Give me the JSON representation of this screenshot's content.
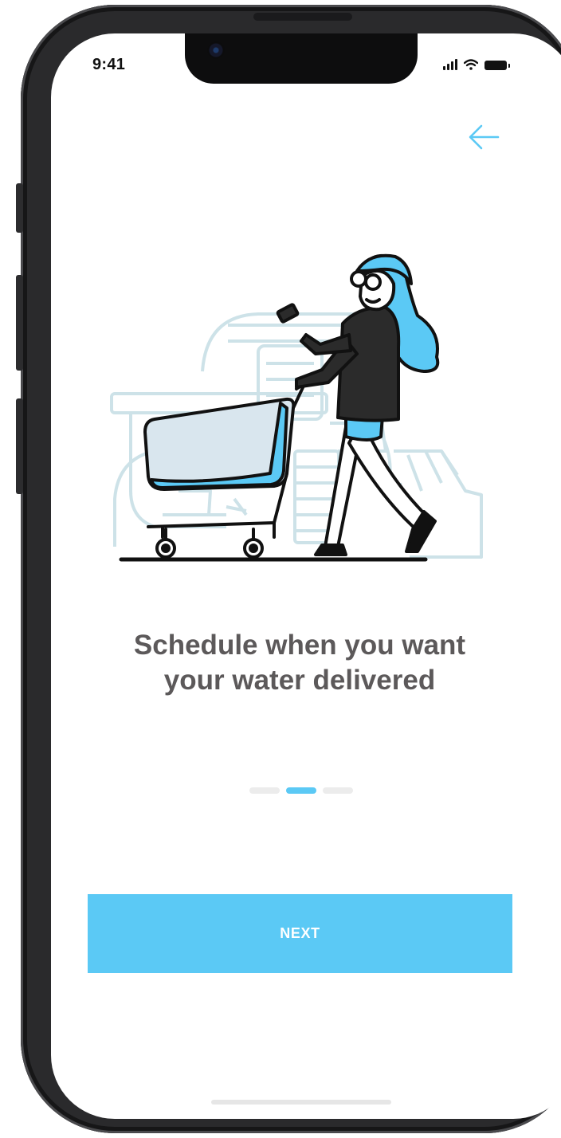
{
  "status_bar": {
    "time": "9:41"
  },
  "onboarding": {
    "headline_line1": "Schedule when you want",
    "headline_line2": "your water delivered",
    "total_steps": 3,
    "current_step": 2,
    "next_label": "NEXT"
  },
  "colors": {
    "accent": "#5bc9f5",
    "headline": "#5c595a",
    "inactive_dot": "#ececec",
    "illustration_outline": "#cde2e8"
  },
  "icons": {
    "back": "arrow-left-icon",
    "signal": "cellular-signal-icon",
    "wifi": "wifi-icon",
    "battery": "battery-icon"
  }
}
